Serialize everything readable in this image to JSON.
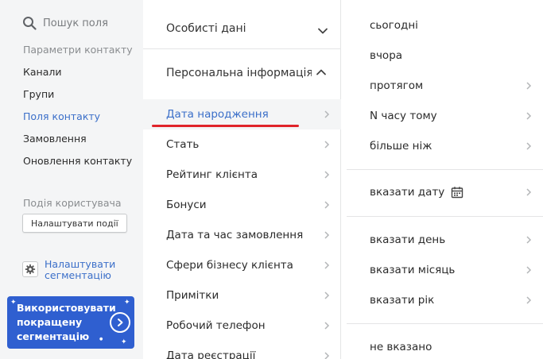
{
  "sidebar": {
    "search_label": "Пошук поля",
    "contact_params_heading": "Параметри контакту",
    "items": [
      {
        "label": "Канали"
      },
      {
        "label": "Групи"
      },
      {
        "label": "Поля контакту"
      },
      {
        "label": "Замовлення"
      },
      {
        "label": "Оновлення контакту"
      }
    ],
    "user_event_heading": "Подія користувача",
    "configure_events_button": "Налаштувати події",
    "configure_segmentation_link": "Налаштувати сегментацію",
    "promo_text": "Використовувати покращену сегментацію",
    "accent_color": "#3b6fc9",
    "promo_color": "#2f5fd0"
  },
  "middle": {
    "sections": [
      {
        "label": "Особисті дані",
        "state": "collapsed"
      },
      {
        "label": "Персональна інформація",
        "state": "expanded"
      }
    ],
    "items": [
      {
        "label": "Дата народження"
      },
      {
        "label": "Стать"
      },
      {
        "label": "Рейтинг клієнта"
      },
      {
        "label": "Бонуси"
      },
      {
        "label": "Дата та час замовлення"
      },
      {
        "label": "Сфери бізнесу клієнта"
      },
      {
        "label": "Примітки"
      },
      {
        "label": "Робочий телефон"
      },
      {
        "label": "Дата реєстрації"
      }
    ],
    "selected_item": "Дата народження",
    "highlight_color": "#e0242a"
  },
  "right": {
    "items": [
      {
        "label": "сьогодні",
        "has_arrow": false
      },
      {
        "label": "вчора",
        "has_arrow": false
      },
      {
        "label": "протягом",
        "has_arrow": true
      },
      {
        "label": "N часу тому",
        "has_arrow": true
      },
      {
        "label": "більше ніж",
        "has_arrow": true
      },
      {
        "label": "вказати дату",
        "has_arrow": true,
        "icon": "calendar-icon"
      },
      {
        "label": "вказати день",
        "has_arrow": true
      },
      {
        "label": "вказати місяць",
        "has_arrow": true
      },
      {
        "label": "вказати рік",
        "has_arrow": true
      },
      {
        "label": "не вказано",
        "has_arrow": false
      }
    ]
  }
}
